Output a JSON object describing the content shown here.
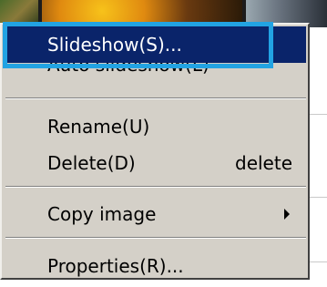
{
  "context_menu": {
    "items": [
      {
        "label": "Slideshow(S)..."
      },
      {
        "label": "Auto slideshow(L)"
      },
      {
        "label": "Rename(U)"
      },
      {
        "label": "Delete(D)",
        "shortcut": "delete"
      },
      {
        "label": "Copy image",
        "submenu": true
      },
      {
        "label": "Properties(R)..."
      }
    ],
    "highlighted_item": "Slideshow(S)...",
    "colors": {
      "menu_background": "#d4d0c8",
      "selection_background": "#0a246a",
      "selection_text": "#ffffff",
      "focus_frame": "#22a3e3"
    }
  }
}
